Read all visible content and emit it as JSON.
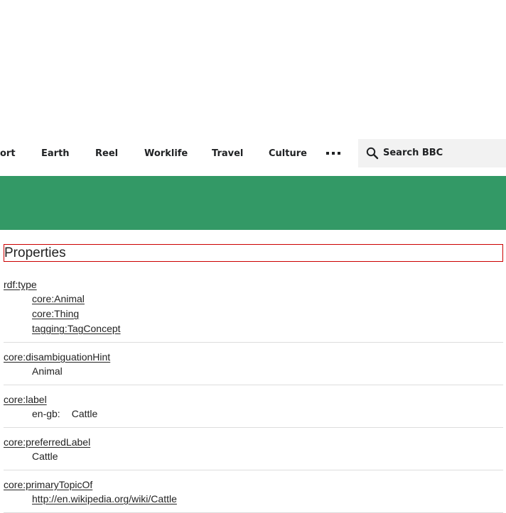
{
  "nav": {
    "items": [
      "ort",
      "Earth",
      "Reel",
      "Worklife",
      "Travel",
      "Culture"
    ],
    "more_icon": "ellipsis-icon",
    "search": {
      "icon": "search-icon",
      "placeholder": "Search BBC"
    }
  },
  "colors": {
    "band": "#339966",
    "heading_border": "#cc0000"
  },
  "heading": "Properties",
  "properties": [
    {
      "key": "rdf:type",
      "values": [
        "core:Animal",
        "core:Thing",
        "tagging:TagConcept"
      ]
    },
    {
      "key": "core:disambiguationHint",
      "values": [
        "Animal"
      ]
    },
    {
      "key": "core:label",
      "lang": "en-gb:",
      "values": [
        "Cattle"
      ]
    },
    {
      "key": "core:preferredLabel",
      "values": [
        "Cattle"
      ]
    },
    {
      "key": "core:primaryTopicOf",
      "values": [
        "http://en.wikipedia.org/wiki/Cattle"
      ]
    }
  ]
}
